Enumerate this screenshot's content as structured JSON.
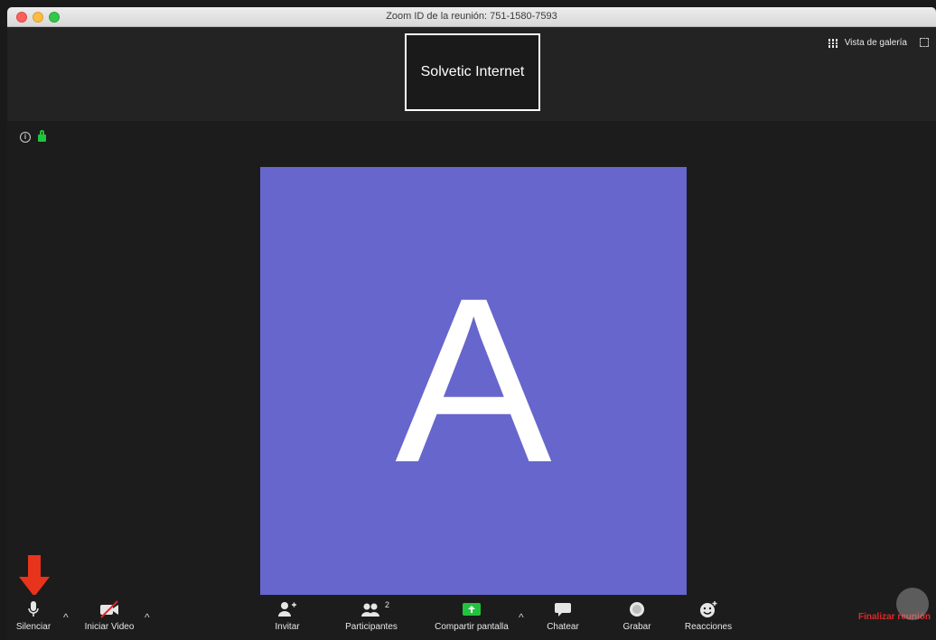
{
  "window": {
    "title": "Zoom ID de la reunión: 751-1580-7593"
  },
  "header": {
    "tile_name": "Solvetic Internet",
    "gallery_label": "Vista de galería"
  },
  "video": {
    "avatar_letter": "A",
    "avatar_color": "#6666cc"
  },
  "toolbar": {
    "mute_label": "Silenciar",
    "video_label": "Iniciar Video",
    "invite_label": "Invitar",
    "participants_label": "Participantes",
    "participants_count": "2",
    "share_label": "Compartir pantalla",
    "chat_label": "Chatear",
    "record_label": "Grabar",
    "reactions_label": "Reacciones",
    "end_label": "Finalizar reunión"
  },
  "colors": {
    "accent_green": "#21c43d",
    "end_red": "#e02828",
    "annotation_arrow": "#e8341c"
  }
}
